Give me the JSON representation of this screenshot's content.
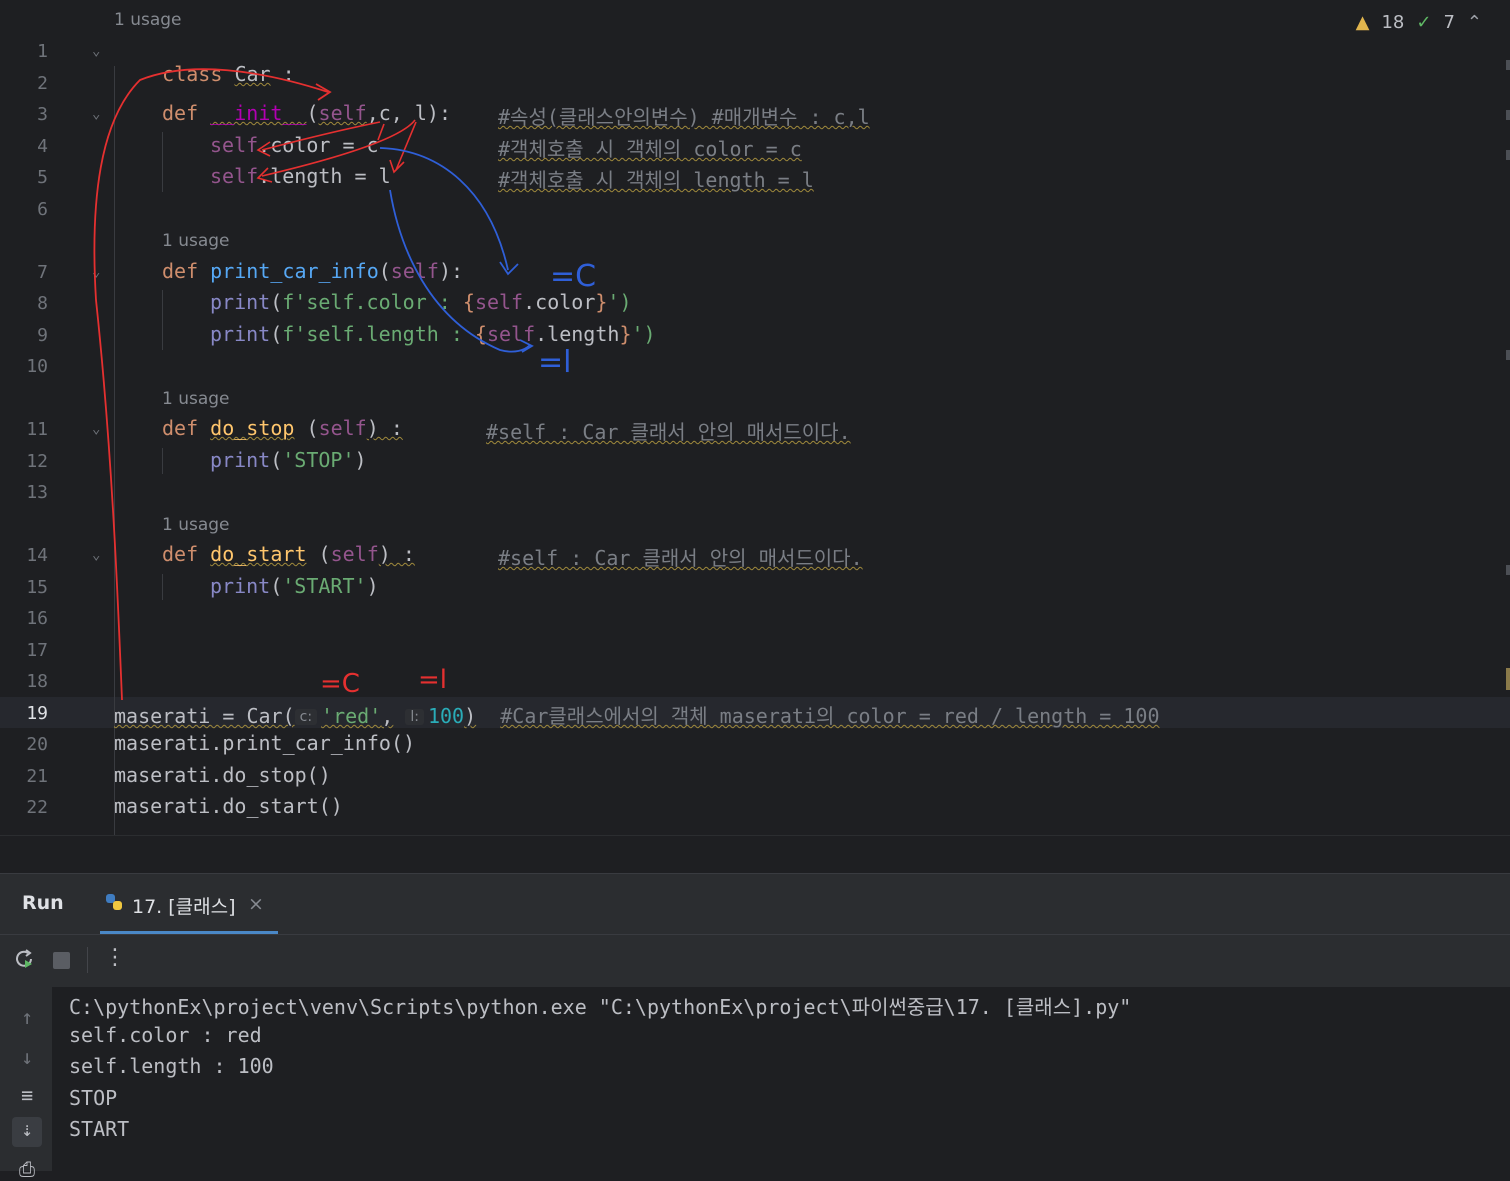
{
  "editor": {
    "inspections": {
      "warnings": "18",
      "weak_warnings": "7"
    },
    "usage_label": "1 usage",
    "line_numbers": [
      "1",
      "2",
      "3",
      "4",
      "5",
      "6",
      "7",
      "8",
      "9",
      "10",
      "11",
      "12",
      "13",
      "14",
      "15",
      "16",
      "17",
      "18",
      "19",
      "20",
      "21",
      "22"
    ],
    "code": {
      "l1_kw": "class",
      "l1_name": "Car",
      "l1_colon": ":",
      "l3_def": "def",
      "l3_name": "__init__",
      "l3_open": "(",
      "l3_self": "self",
      "l3_rest": ",c, l):",
      "l3_comment": "#속성(클래스안의변수) #매개변수 : c,l",
      "l4_self": "self",
      "l4_rest": ".color = c",
      "l4_comment": "#객체호출 시 객체의 color = c",
      "l5_self": "self",
      "l5_rest": ".length = l",
      "l5_comment": "#객체호출 시 객체의 length = l",
      "l7_def": "def",
      "l7_name": "print_car_info",
      "l7_open": "(",
      "l7_self": "self",
      "l7_close": "):",
      "l8_print": "print",
      "l8_open": "(",
      "l8_fstr": "f'self.color : ",
      "l8_brace1": "{",
      "l8_self": "self",
      "l8_attr": ".color",
      "l8_brace2": "}",
      "l8_end": "')",
      "l9_print": "print",
      "l9_open": "(",
      "l9_fstr": "f'self.length : ",
      "l9_brace1": "{",
      "l9_self": "self",
      "l9_attr": ".length",
      "l9_brace2": "}",
      "l9_end": "')",
      "l11_def": "def",
      "l11_name": "do_stop",
      "l11_open": " (",
      "l11_self": "self",
      "l11_close": ") :",
      "l11_comment": "#self : Car 클래서 안의 매서드이다.",
      "l12_print": "print",
      "l12_open": "(",
      "l12_str": "'STOP'",
      "l12_close": ")",
      "l14_def": "def",
      "l14_name": "do_start",
      "l14_open": " (",
      "l14_self": "self",
      "l14_close": ") :",
      "l14_comment": "#self : Car 클래서 안의 매서드이다.",
      "l15_print": "print",
      "l15_open": "(",
      "l15_str": "'START'",
      "l15_close": ")",
      "l19_var": "maserati = Car(",
      "l19_hint_c": "c:",
      "l19_str": "'red'",
      "l19_comma": ",",
      "l19_hint_l": "l:",
      "l19_num": "100",
      "l19_close": ")",
      "l19_comment": "#Car클래스에서의 객체 maserati의 color = red / length = 100",
      "l20": "maserati.print_car_info()",
      "l21": "maserati.do_stop()",
      "l22": "maserati.do_start()"
    },
    "annotations": {
      "blue_c": "=C",
      "blue_l": "=l",
      "red_c": "=C",
      "red_l": "=l"
    }
  },
  "run_panel": {
    "title": "Run",
    "tab_label": "17. [클래스]",
    "close_glyph": "×",
    "console_lines": [
      "C:\\pythonEx\\project\\venv\\Scripts\\python.exe \"C:\\pythonEx\\project\\파이썬중급\\17. [클래스].py\"",
      "self.color : red",
      "self.length : 100",
      "STOP",
      "START"
    ]
  },
  "colors": {
    "accent": "#4a88c7",
    "keyword": "#cf8e6d",
    "function": "#56a8f5",
    "self": "#94558d",
    "string": "#6aab73",
    "number": "#2aacb8",
    "comment": "#7a7e85",
    "red_pen": "#e53030",
    "blue_pen": "#2f5fd8"
  }
}
